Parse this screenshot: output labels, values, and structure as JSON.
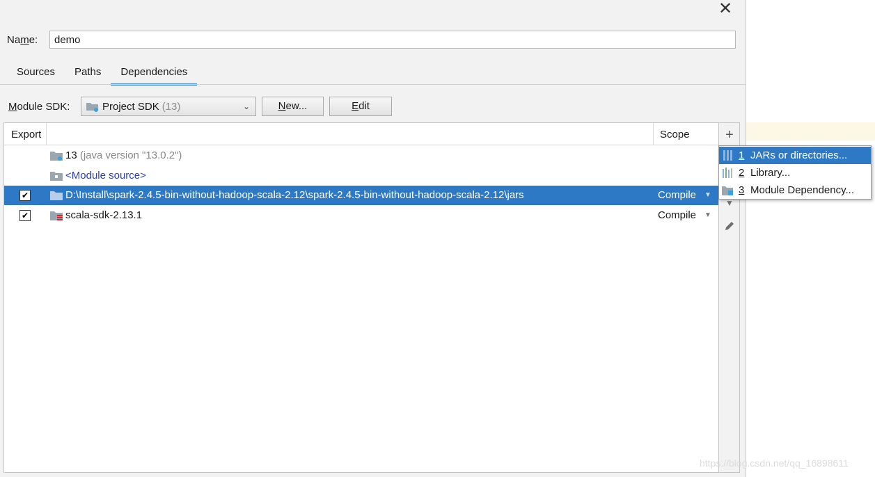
{
  "dialog": {
    "name_label": "Name:",
    "name_value": "demo",
    "tabs": [
      {
        "label": "Sources",
        "active": false
      },
      {
        "label": "Paths",
        "active": false
      },
      {
        "label": "Dependencies",
        "active": true
      }
    ],
    "close_icon": "close-icon"
  },
  "sdk": {
    "label": "Module SDK:",
    "selected": "Project SDK",
    "selected_suffix": "(13)",
    "new_button": "New...",
    "edit_button": "Edit"
  },
  "table": {
    "col_export": "Export",
    "col_scope": "Scope",
    "rows": [
      {
        "checkbox": false,
        "icon": "sdk-folder-icon",
        "text": "13",
        "muted": "(java version \"13.0.2\")",
        "scope": "",
        "selected": false
      },
      {
        "checkbox": false,
        "icon": "module-source-icon",
        "text": "<Module source>",
        "muted": "",
        "scope": "",
        "selected": false
      },
      {
        "checkbox": true,
        "icon": "folder-icon",
        "text": "D:\\Install\\spark-2.4.5-bin-without-hadoop-scala-2.12\\spark-2.4.5-bin-without-hadoop-scala-2.12\\jars",
        "muted": "",
        "scope": "Compile",
        "selected": true
      },
      {
        "checkbox": true,
        "icon": "scala-library-icon",
        "text": "scala-sdk-2.13.1",
        "muted": "",
        "scope": "Compile",
        "selected": false
      }
    ]
  },
  "toolbar": {
    "add": "+",
    "edit_icon": "pencil-icon",
    "move_down_icon": "arrow-down-icon"
  },
  "popup": {
    "items": [
      {
        "num": "1",
        "label": "JARs or directories...",
        "icon": "jar-icon",
        "selected": true
      },
      {
        "num": "2",
        "label": "Library...",
        "icon": "library-icon",
        "selected": false
      },
      {
        "num": "3",
        "label": "Module Dependency...",
        "icon": "module-icon",
        "selected": false
      }
    ]
  },
  "watermark": "https://blog.csdn.net/qq_16898611",
  "colors": {
    "selection": "#2e79c5",
    "accent_tab": "#4083c9",
    "link": "#2a3fb8"
  }
}
